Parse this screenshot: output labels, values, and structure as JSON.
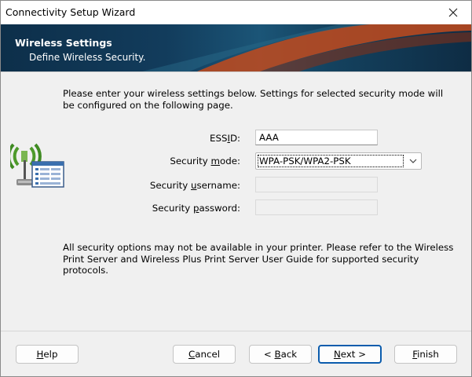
{
  "window": {
    "title": "Connectivity Setup Wizard",
    "close_icon": "close-icon"
  },
  "banner": {
    "title": "Wireless Settings",
    "subtitle": "Define Wireless Security."
  },
  "intro_text": "Please enter your wireless settings below. Settings for selected security mode will be configured on the following page.",
  "form": {
    "essid": {
      "label_pre": "ESS",
      "label_u": "I",
      "label_post": "D:",
      "value": "AAA"
    },
    "security_mode": {
      "label_pre": "Security ",
      "label_u": "m",
      "label_post": "ode:",
      "value": "WPA-PSK/WPA2-PSK"
    },
    "security_username": {
      "label_pre": "Security ",
      "label_u": "u",
      "label_post": "sername:",
      "value": ""
    },
    "security_password": {
      "label_pre": "Security ",
      "label_u": "p",
      "label_post": "assword:",
      "value": ""
    }
  },
  "note_text": "All security options may not be available in your printer. Please refer to the Wireless Print Server and Wireless Plus Print Server User Guide for supported security protocols.",
  "buttons": {
    "help": {
      "u": "H",
      "rest": "elp"
    },
    "cancel": {
      "u": "C",
      "rest": "ancel"
    },
    "back": {
      "pre": "< ",
      "u": "B",
      "rest": "ack"
    },
    "next": {
      "u": "N",
      "rest": "ext >"
    },
    "finish": {
      "u": "F",
      "rest": "inish"
    }
  },
  "colors": {
    "banner_dark": "#0d2f4a",
    "banner_accent": "#c24a1c",
    "primary_border": "#0b5cad"
  },
  "icons": [
    "close-icon",
    "wireless-printer-icon",
    "chevron-down-icon"
  ]
}
